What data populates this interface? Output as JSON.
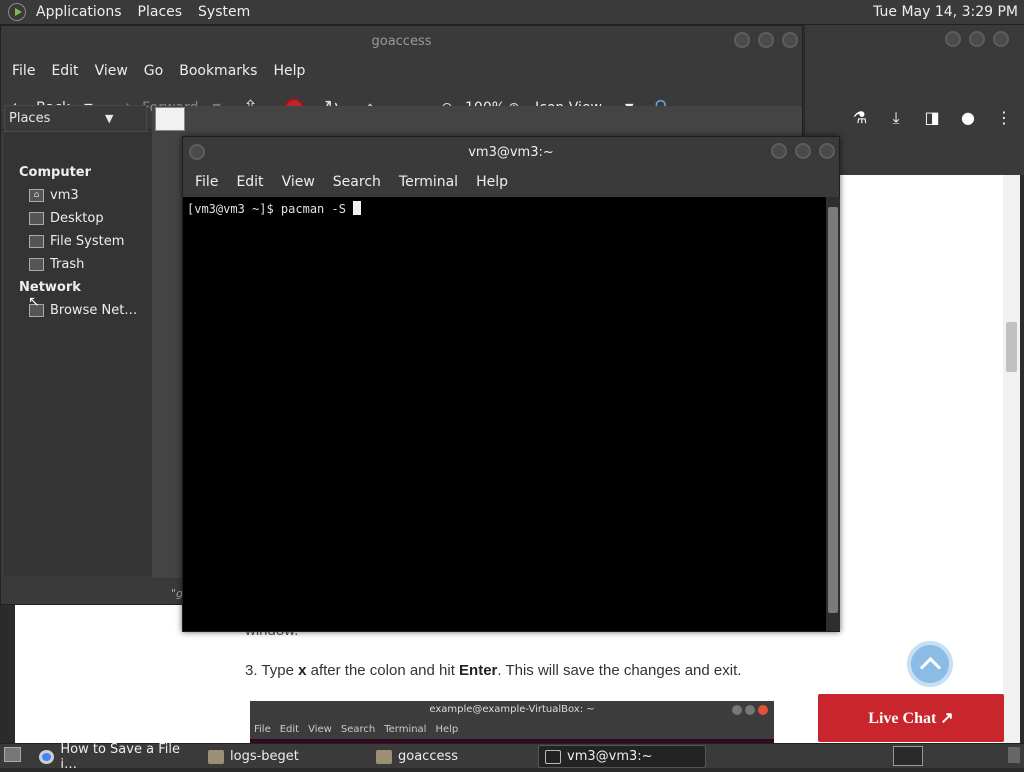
{
  "top_panel": {
    "menus": [
      "Applications",
      "Places",
      "System"
    ],
    "clock": "Tue May 14,  3:29 PM"
  },
  "browser": {
    "page_partial_text": "window.",
    "page_step_text_parts": [
      "3. Type ",
      "x",
      " after the colon and hit ",
      "Enter",
      ". This will save the changes and exit."
    ],
    "live_chat_label": "Live Chat ↗",
    "embedded_terminal": {
      "title": "example@example-VirtualBox: ~",
      "menus": [
        "File",
        "Edit",
        "View",
        "Search",
        "Terminal",
        "Help"
      ]
    }
  },
  "file_manager": {
    "title": "goaccess",
    "menus": [
      "File",
      "Edit",
      "View",
      "Go",
      "Bookmarks",
      "Help"
    ],
    "toolbar": {
      "back": "Back",
      "forward": "Forward",
      "zoom": "100%",
      "view_mode": "Icon View"
    },
    "sidebar": {
      "header": "Places",
      "sections": [
        {
          "title": "Computer",
          "items": [
            "vm3",
            "Desktop",
            "File System",
            "Trash"
          ]
        },
        {
          "title": "Network",
          "items": [
            "Browse Net…"
          ]
        }
      ]
    },
    "path_fragment": "\"g"
  },
  "terminal": {
    "title": "vm3@vm3:~",
    "menus": [
      "File",
      "Edit",
      "View",
      "Search",
      "Terminal",
      "Help"
    ],
    "prompt": "[vm3@vm3 ~]$ pacman -S "
  },
  "taskbar": {
    "tasks": [
      {
        "label": "How to Save a File i…",
        "icon": "chrome-icon"
      },
      {
        "label": "logs-beget",
        "icon": "folder-icon"
      },
      {
        "label": "goaccess",
        "icon": "folder-icon"
      },
      {
        "label": "vm3@vm3:~",
        "icon": "terminal-icon"
      }
    ]
  },
  "colors": {
    "panel": "#3a3a3a",
    "live_chat": "#c9252d",
    "terminal_bg": "#000000"
  }
}
